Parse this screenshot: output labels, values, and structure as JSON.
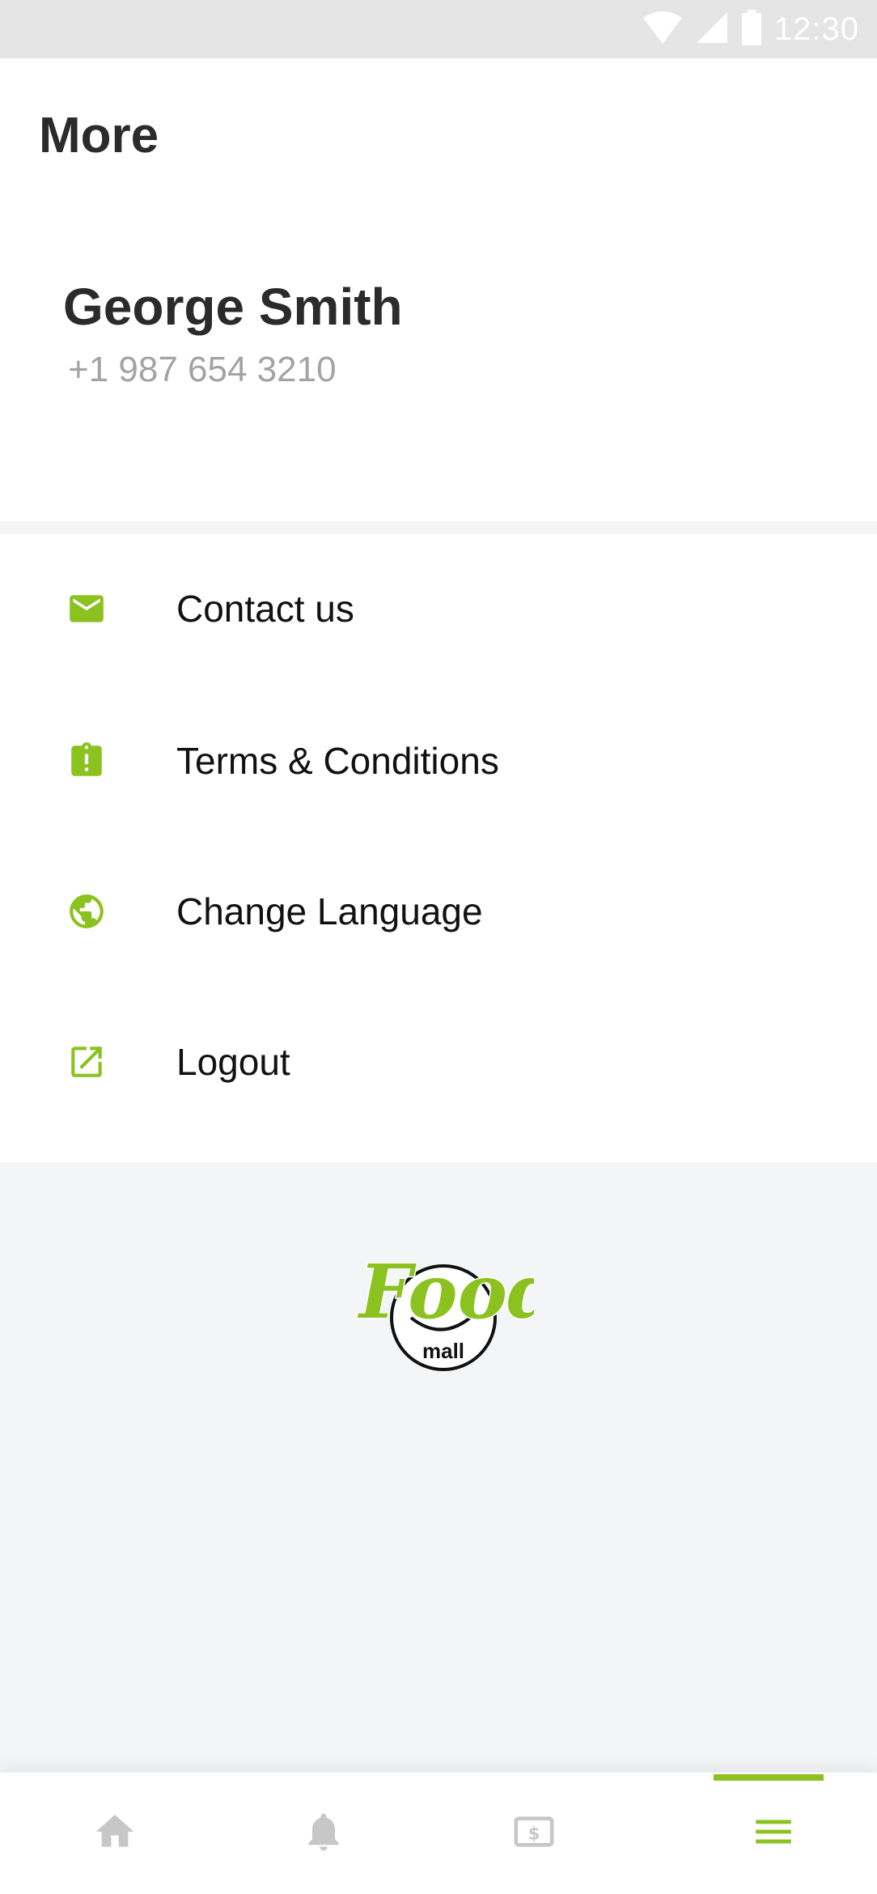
{
  "status_bar": {
    "time": "12:30"
  },
  "header": {
    "title": "More"
  },
  "profile": {
    "name": "George Smith",
    "phone": "+1 987 654 3210"
  },
  "menu": {
    "items": [
      {
        "label": "Contact us",
        "icon": "mail-icon"
      },
      {
        "label": "Terms & Conditions",
        "icon": "clipboard-alert-icon"
      },
      {
        "label": "Change Language",
        "icon": "globe-icon"
      },
      {
        "label": "Logout",
        "icon": "open-in-new-icon"
      }
    ]
  },
  "logo": {
    "text": "Food",
    "subtext": "mall"
  },
  "bottom_nav": {
    "items": [
      {
        "icon": "home-icon",
        "active": false
      },
      {
        "icon": "bell-icon",
        "active": false
      },
      {
        "icon": "money-icon",
        "active": false
      },
      {
        "icon": "menu-icon",
        "active": true
      }
    ]
  },
  "colors": {
    "accent": "#8cc21f",
    "inactive": "#c7c7c7",
    "text": "#2b2b2b",
    "secondary_text": "#a3a3a3"
  }
}
